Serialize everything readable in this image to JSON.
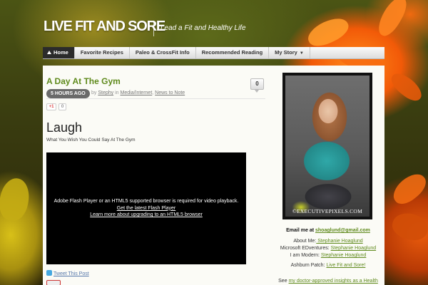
{
  "header": {
    "site_title": "LIVE FIT AND SORE",
    "tagline": "Lead a Fit and Healthy Life"
  },
  "nav": {
    "items": [
      {
        "label": "Home"
      },
      {
        "label": "Favorite Recipes"
      },
      {
        "label": "Paleo & CrossFit Info"
      },
      {
        "label": "Recommended Reading"
      },
      {
        "label": "My Story"
      }
    ]
  },
  "post": {
    "title": "A Day At The Gym",
    "comment_count": "0",
    "time_badge": "5 HOURS AGO",
    "by": "by",
    "author": "Stephy",
    "in": "in",
    "category1": "Media/Internet",
    "comma": ",",
    "category2": "News to Note",
    "gplus_label": "+1",
    "gplus_count": "0",
    "heading": "Laugh",
    "subheading": "What You Wish You Could Say At The Gym",
    "video_msg_line1": "Adobe Flash Player or an HTML5 supported browser is required for video playback.",
    "video_msg_line2": "Get the latest Flash Player",
    "video_msg_line3": "Learn more about upgrading to an HTML5 browser",
    "tweet_label": "Tweet This Post"
  },
  "sidebar": {
    "photo_caption": "©EXECUTIVEPIXELS.COM",
    "email_label": "Email me at",
    "email": "shoaglund@gmail.com",
    "about_label": "About Me:",
    "about_link": " Stephanie Hoaglund",
    "edventures_label": "Microsoft EDventures:",
    "edventures_link": "Stephanie Hoaglund",
    "modern_label": "I am Modern:",
    "modern_link": "Stephanie Hoaglund",
    "patch_label": "Ashburn Patch:",
    "patch_link": "Live Fit and Sore!",
    "see_label": "See",
    "see_link": "my doctor-approved insights as a Health"
  },
  "colors": {
    "accent_green": "#5f8a1c",
    "nav_home_bg": "#2b2b2b",
    "content_bg": "#fbfbf6"
  },
  "icons": [
    "home-icon",
    "chevron-down-icon",
    "comment-bubble-icon",
    "twitter-icon",
    "google-plus-icon",
    "pinterest-icon"
  ]
}
